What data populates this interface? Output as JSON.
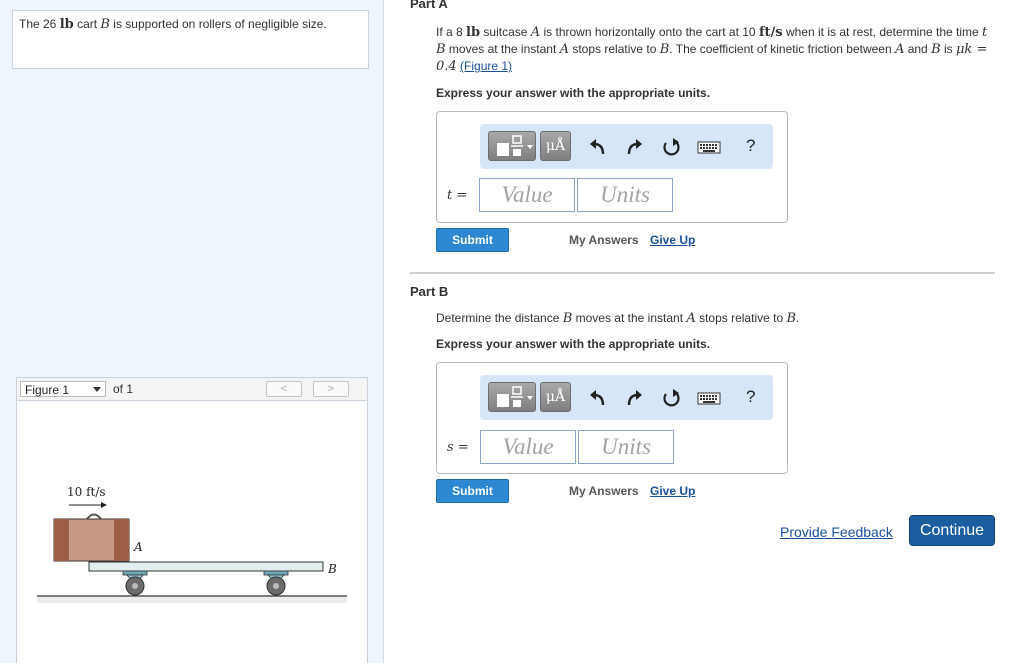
{
  "intro": {
    "t1": "The 26 ",
    "unit": "lb",
    "t2": " cart ",
    "var": "B",
    "t3": " is supported on rollers of negligible size."
  },
  "figure": {
    "select_value": "Figure 1",
    "of_text": "of 1",
    "prev": "<",
    "next": ">",
    "velocity_label": "10 ft/s",
    "label_a": "A",
    "label_b": "B"
  },
  "partA": {
    "title": "Part A",
    "p1": "If a 8 ",
    "p1_unit": "lb",
    "p2": " suitcase ",
    "p2_var": "A",
    "p3": " is thrown horizontally onto the cart at 10 ",
    "p3_unit": "ft/s",
    "p4": " when it is at rest, determine the time ",
    "p4_var": "t",
    "p5": " ",
    "p5_var": "B",
    "p6": " moves at the instant ",
    "p6_var": "A",
    "p7": " stops relative to ",
    "p7_var": "B",
    "p8": ". The coefficient of kinetic friction between ",
    "p8_var": "A",
    "p9": " and ",
    "p9_var": "B",
    "p10": " is ",
    "mu": "μk = 0.4",
    "p11": " ",
    "figure_link": "(Figure 1)",
    "instruction": "Express your answer with the appropriate units.",
    "var_label": "t =",
    "value_placeholder": "Value",
    "units_placeholder": "Units",
    "submit": "Submit",
    "my_answers": "My Answers",
    "give_up": "Give Up"
  },
  "partB": {
    "title": "Part B",
    "p1": "Determine the distance ",
    "p1_var": "B",
    "p2": " moves at the instant ",
    "p2_var": "A",
    "p3": " stops relative to ",
    "p3_var": "B",
    "p4": ".",
    "instruction": "Express your answer with the appropriate units.",
    "var_label": "s =",
    "value_placeholder": "Value",
    "units_placeholder": "Units",
    "submit": "Submit",
    "my_answers": "My Answers",
    "give_up": "Give Up"
  },
  "toolbar": {
    "units_symbol": "μÅ",
    "help": "?"
  },
  "footer": {
    "feedback": "Provide Feedback",
    "continue": "Continue"
  },
  "colors": {
    "submit_blue": "#2e88d1",
    "continue_navy": "#1a5e9f",
    "toolbar_bg": "#d6e6f8",
    "left_panel_bg": "#eef5fc"
  }
}
